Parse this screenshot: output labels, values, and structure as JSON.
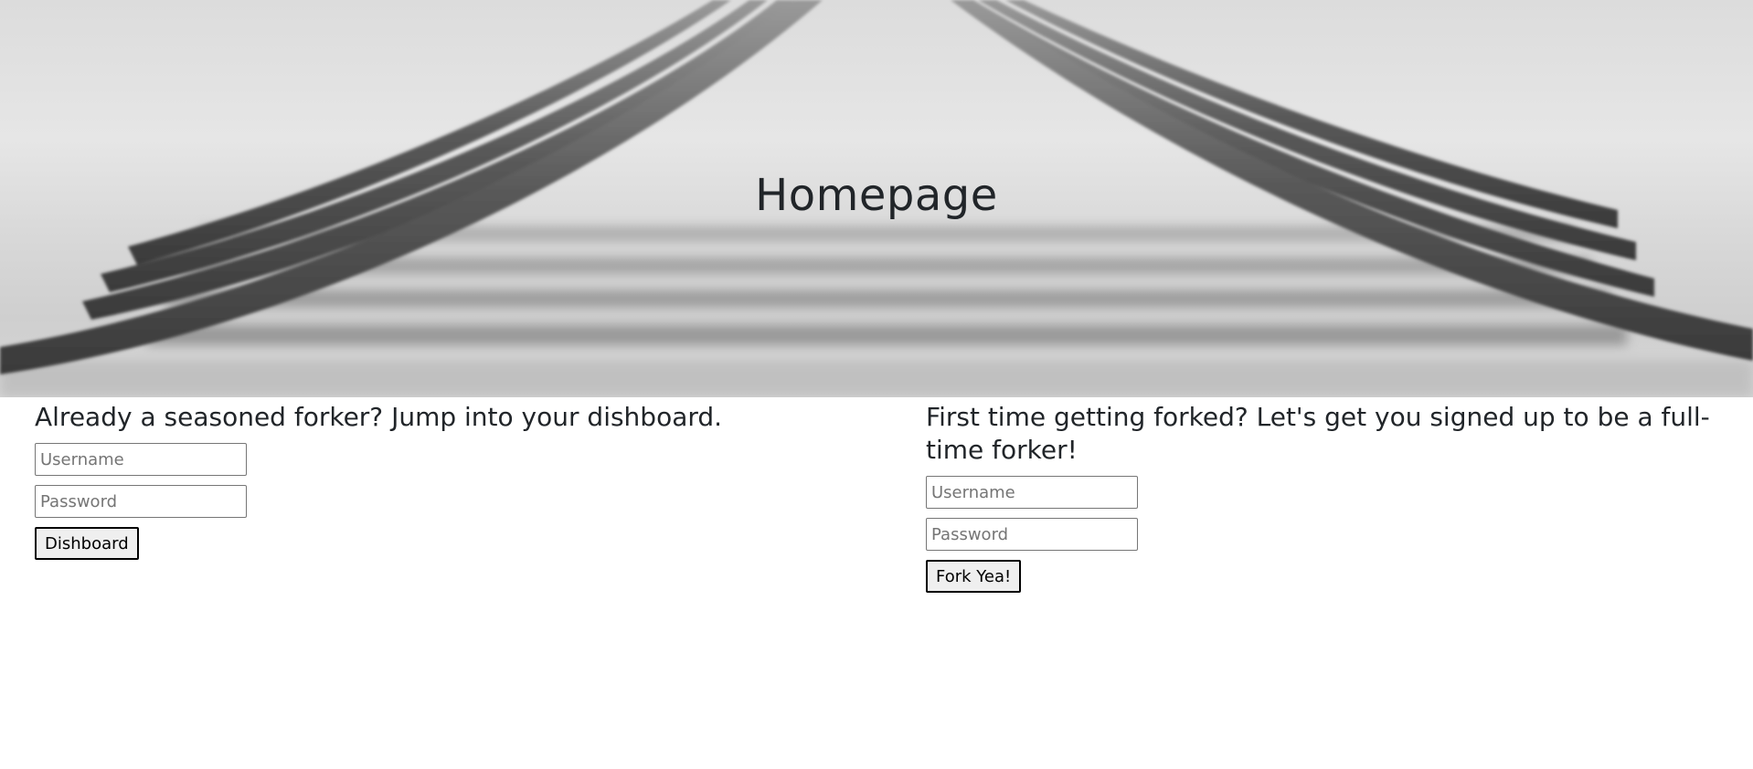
{
  "hero": {
    "title": "Homepage"
  },
  "login": {
    "heading": "Already a seasoned forker? Jump into your dishboard.",
    "username_placeholder": "Username",
    "password_placeholder": "Password",
    "button_label": "Dishboard"
  },
  "signup": {
    "heading": "First time getting forked? Let's get you signed up to be a full-time forker!",
    "username_placeholder": "Username",
    "password_placeholder": "Password",
    "button_label": "Fork Yea!"
  },
  "colors": {
    "text": "#212529",
    "hero_background": "#e2e2e2",
    "button_background": "#efefef",
    "input_border": "#767676"
  }
}
